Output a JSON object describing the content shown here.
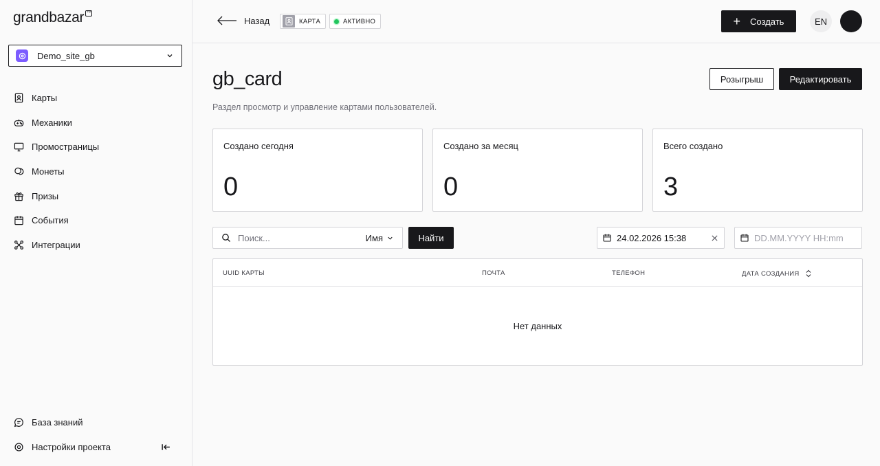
{
  "brand": {
    "name": "grandbazar",
    "badge": "™"
  },
  "project": {
    "name": "Demo_site_gb"
  },
  "nav": {
    "items": [
      {
        "label": "Карты",
        "icon": "card-icon"
      },
      {
        "label": "Механики",
        "icon": "gamepad-icon"
      },
      {
        "label": "Промостраницы",
        "icon": "monitor-icon"
      },
      {
        "label": "Монеты",
        "icon": "coins-icon"
      },
      {
        "label": "Призы",
        "icon": "gift-icon"
      },
      {
        "label": "События",
        "icon": "calendar-icon"
      },
      {
        "label": "Интеграции",
        "icon": "integrations-icon"
      }
    ],
    "bottom": [
      {
        "label": "База знаний",
        "icon": "chat-icon"
      },
      {
        "label": "Настройки проекта",
        "icon": "gear-icon"
      }
    ]
  },
  "topbar": {
    "back_label": "Назад",
    "tag_type": "КАРТА",
    "tag_status": "АКТИВНО",
    "create_label": "Создать",
    "lang": "EN"
  },
  "page": {
    "title": "gb_card",
    "description": "Раздел просмотр и управление картами пользователей.",
    "raffle_label": "Розыгрыш",
    "edit_label": "Редактировать"
  },
  "stats": [
    {
      "label": "Создано сегодня",
      "value": "0"
    },
    {
      "label": "Создано за месяц",
      "value": "0"
    },
    {
      "label": "Всего создано",
      "value": "3"
    }
  ],
  "filters": {
    "search_placeholder": "Поиск...",
    "search_field": "Имя",
    "find_label": "Найти",
    "date_from": "24.02.2026 15:38",
    "date_to_placeholder": "DD.MM.YYYY HH:mm"
  },
  "table": {
    "columns": [
      "UUID КАРТЫ",
      "ПОЧТА",
      "ТЕЛЕФОН",
      "ДАТА СОЗДАНИЯ"
    ],
    "empty_text": "Нет данных"
  },
  "colors": {
    "accent": "#18181b",
    "project_avatar": "#7c5cff",
    "status_active": "#22c55e"
  }
}
